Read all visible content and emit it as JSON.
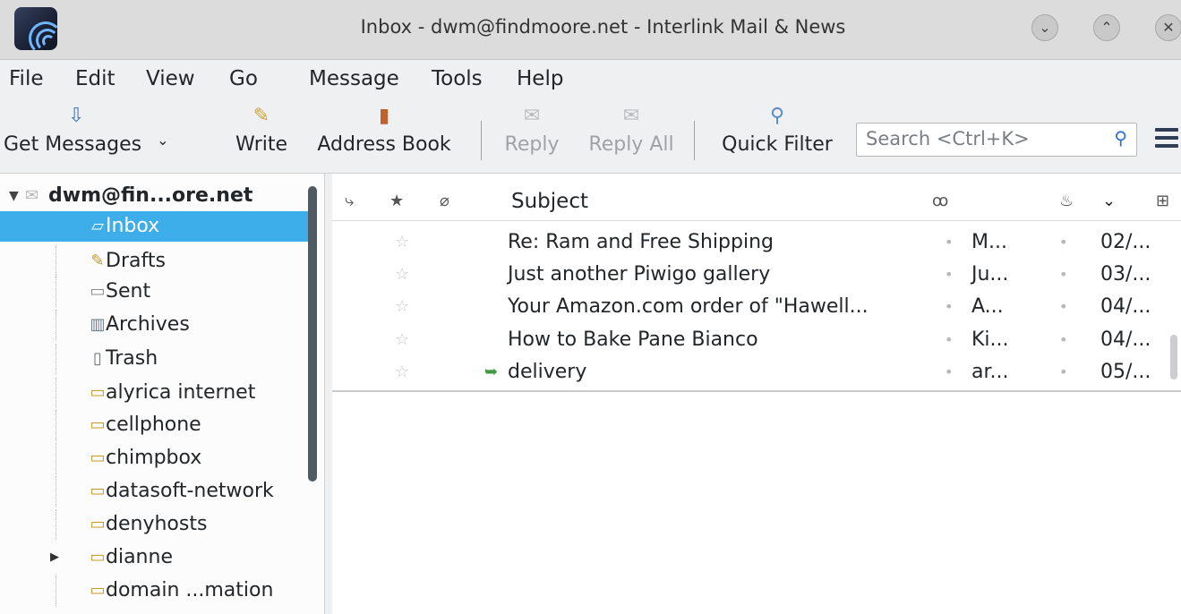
{
  "window": {
    "title": "Inbox - dwm@findmoore.net - Interlink Mail & News",
    "buttons": [
      "minimize",
      "maximize",
      "close"
    ]
  },
  "menu": [
    {
      "label": "File"
    },
    {
      "label": "Edit"
    },
    {
      "label": "View"
    },
    {
      "label": "Go"
    },
    {
      "label": "Message"
    },
    {
      "label": "Tools"
    },
    {
      "label": "Help"
    }
  ],
  "toolbar": {
    "get_messages": "Get Messages",
    "write": "Write",
    "address_book": "Address Book",
    "reply": "Reply",
    "reply_all": "Reply All",
    "quick_filter": "Quick Filter",
    "search_placeholder": "Search <Ctrl+K>"
  },
  "folders": {
    "account": "dwm@fin...ore.net",
    "items": [
      {
        "label": "Inbox",
        "icon": "inbox-icon",
        "selected": true
      },
      {
        "label": "Drafts",
        "icon": "pencil-icon"
      },
      {
        "label": "Sent",
        "icon": "sent-icon"
      },
      {
        "label": "Archives",
        "icon": "archive-icon"
      },
      {
        "label": "Trash",
        "icon": "trash-icon"
      },
      {
        "label": "alyrica internet",
        "icon": "folder-icon"
      },
      {
        "label": "cellphone",
        "icon": "folder-icon"
      },
      {
        "label": "chimpbox",
        "icon": "folder-icon"
      },
      {
        "label": "datasoft-network",
        "icon": "folder-icon"
      },
      {
        "label": "denyhosts",
        "icon": "folder-icon"
      },
      {
        "label": "dianne",
        "icon": "folder-icon",
        "collapsed": true
      },
      {
        "label": "domain ...mation",
        "icon": "folder-icon"
      }
    ]
  },
  "thread": {
    "subject_header": "Subject",
    "messages": [
      {
        "subject": "Re: Ram and Free Shipping",
        "from": "M...",
        "date": "02/...",
        "replied": false
      },
      {
        "subject": "Just another Piwigo gallery",
        "from": "Ju...",
        "date": "03/...",
        "replied": false
      },
      {
        "subject": "Your Amazon.com order of \"Hawell...",
        "from": "A...",
        "date": "04/...",
        "replied": false
      },
      {
        "subject": "How to Bake Pane Bianco",
        "from": "Ki...",
        "date": "04/...",
        "replied": false
      },
      {
        "subject": "delivery",
        "from": "ar...",
        "date": "05/...",
        "replied": true
      }
    ]
  },
  "colors": {
    "selection": "#3daee9",
    "accent": "#2a71c9"
  }
}
